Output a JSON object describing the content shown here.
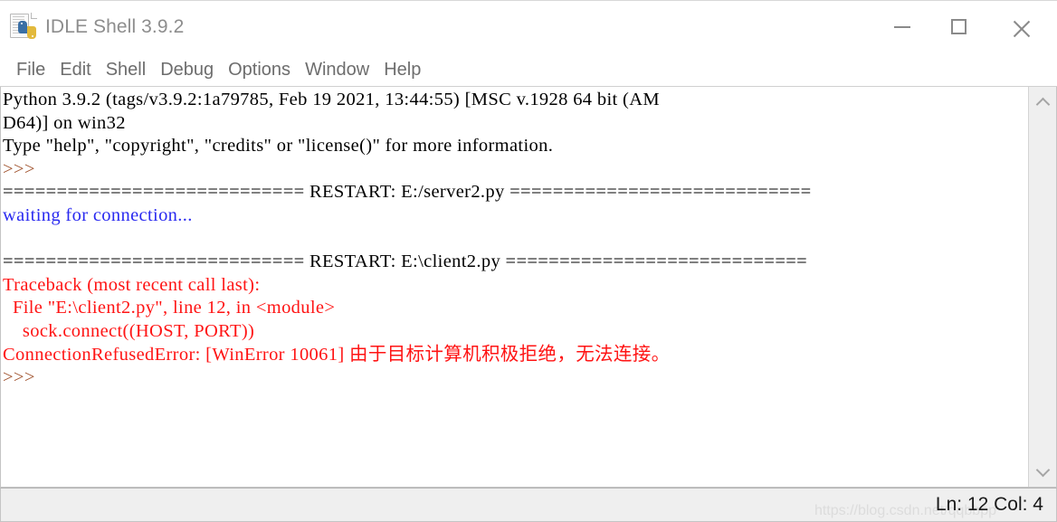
{
  "window": {
    "title": "IDLE Shell 3.9.2",
    "icon": "python-document-icon",
    "controls": {
      "minimize": "minimize-button",
      "maximize": "maximize-button",
      "close": "close-button"
    }
  },
  "menubar": {
    "items": [
      {
        "label": "File"
      },
      {
        "label": "Edit"
      },
      {
        "label": "Shell"
      },
      {
        "label": "Debug"
      },
      {
        "label": "Options"
      },
      {
        "label": "Window"
      },
      {
        "label": "Help"
      }
    ]
  },
  "shell": {
    "lines": [
      {
        "text": "Python 3.9.2 (tags/v3.9.2:1a79785, Feb 19 2021, 13:44:55) [MSC v.1928 64 bit (AM",
        "color": "black"
      },
      {
        "text": "D64)] on win32",
        "color": "black"
      },
      {
        "text": "Type \"help\", \"copyright\", \"credits\" or \"license()\" for more information.",
        "color": "black"
      },
      {
        "text": ">>> ",
        "color": "prompt"
      },
      {
        "text": "============================ RESTART: E:/server2.py ============================",
        "color": "black"
      },
      {
        "text": "waiting for connection...",
        "color": "blue"
      },
      {
        "text": "",
        "color": "black"
      },
      {
        "text": "============================ RESTART: E:\\client2.py ============================",
        "color": "black"
      },
      {
        "text": "Traceback (most recent call last):",
        "color": "red"
      },
      {
        "text": "  File \"E:\\client2.py\", line 12, in <module>",
        "color": "red"
      },
      {
        "text": "    sock.connect((HOST, PORT))",
        "color": "red"
      },
      {
        "text": "ConnectionRefusedError: [WinError 10061] 由于目标计算机积极拒绝，无法连接。",
        "color": "red"
      },
      {
        "text": ">>> ",
        "color": "prompt"
      }
    ]
  },
  "scrollbar": {
    "up_arrow": "scroll-up-arrow",
    "down_arrow": "scroll-down-arrow"
  },
  "statusbar": {
    "position": "Ln: 12  Col: 4",
    "watermark": "https://blog.csdn.net/qqbbpp"
  },
  "colors": {
    "text_black": "#000000",
    "prompt_brown": "#a0522d",
    "stdout_blue": "#2a2af0",
    "error_red": "#ff1414",
    "title_gray": "#8d8d8d",
    "menu_gray": "#6d6d6d",
    "statusbar_bg": "#efefef"
  }
}
